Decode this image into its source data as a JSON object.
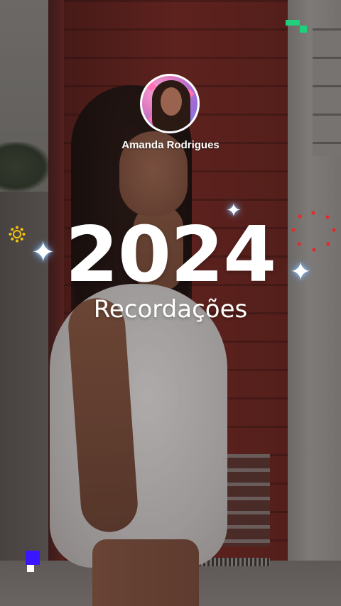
{
  "profile": {
    "username": "Amanda Rodrigues",
    "avatar_icon": "profile-avatar"
  },
  "story": {
    "year": "2024",
    "title": "Recordações"
  },
  "decorations": {
    "sparkle_icon": "sparkle-icon",
    "sun_icon": "sun-icon",
    "ring_icon": "dotted-ring-icon",
    "accent_colors": {
      "sparkle_glow": "#8fc8ff",
      "sun": "#f4c20d",
      "ring": "#e12c2c",
      "green_corner": "#1fd17a",
      "blue_corner": "#3a16ff"
    }
  }
}
